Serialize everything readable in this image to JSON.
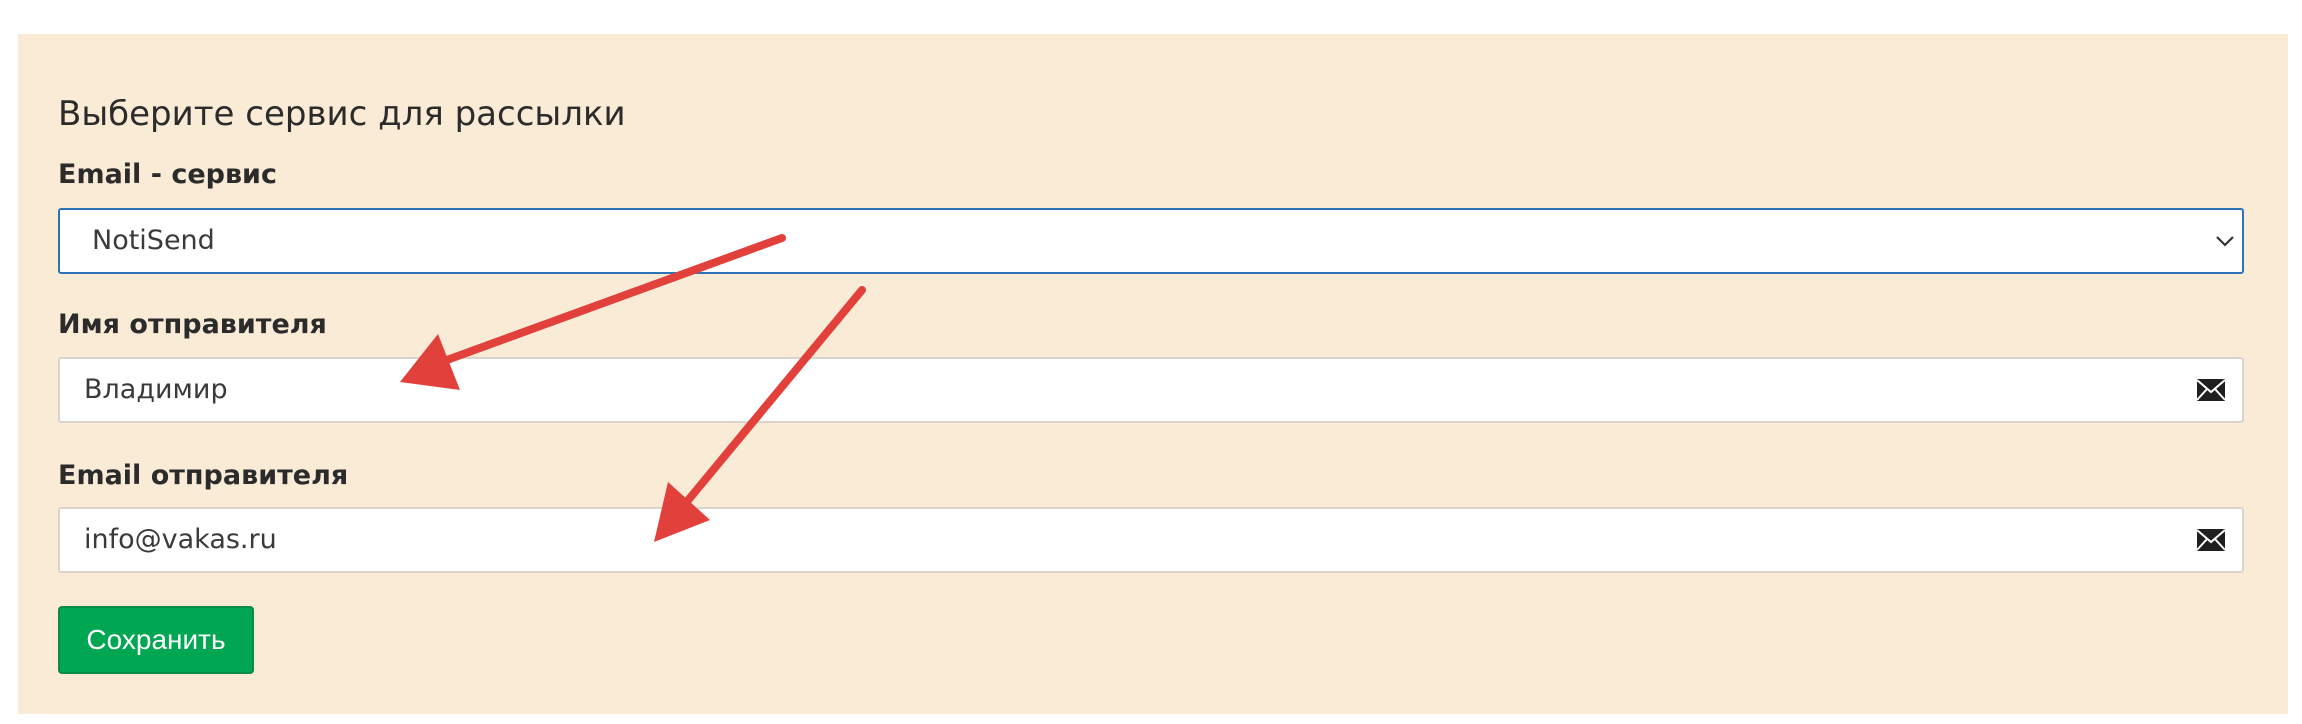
{
  "form": {
    "title": "Выберите сервис для рассылки",
    "service": {
      "label": "Email - сервис",
      "selected": "NotiSend",
      "icon": "chevron-down-icon"
    },
    "sender_name": {
      "label": "Имя отправителя",
      "value": "Владимир",
      "icon": "envelope-icon"
    },
    "sender_email": {
      "label": "Email отправителя",
      "value": "info@vakas.ru",
      "icon": "envelope-icon"
    },
    "save_label": "Сохранить"
  },
  "colors": {
    "panel_background": "#f9ebd6",
    "select_border": "#2e73b8",
    "save_button": "#00a651",
    "annotation_arrow": "#e2403a"
  }
}
